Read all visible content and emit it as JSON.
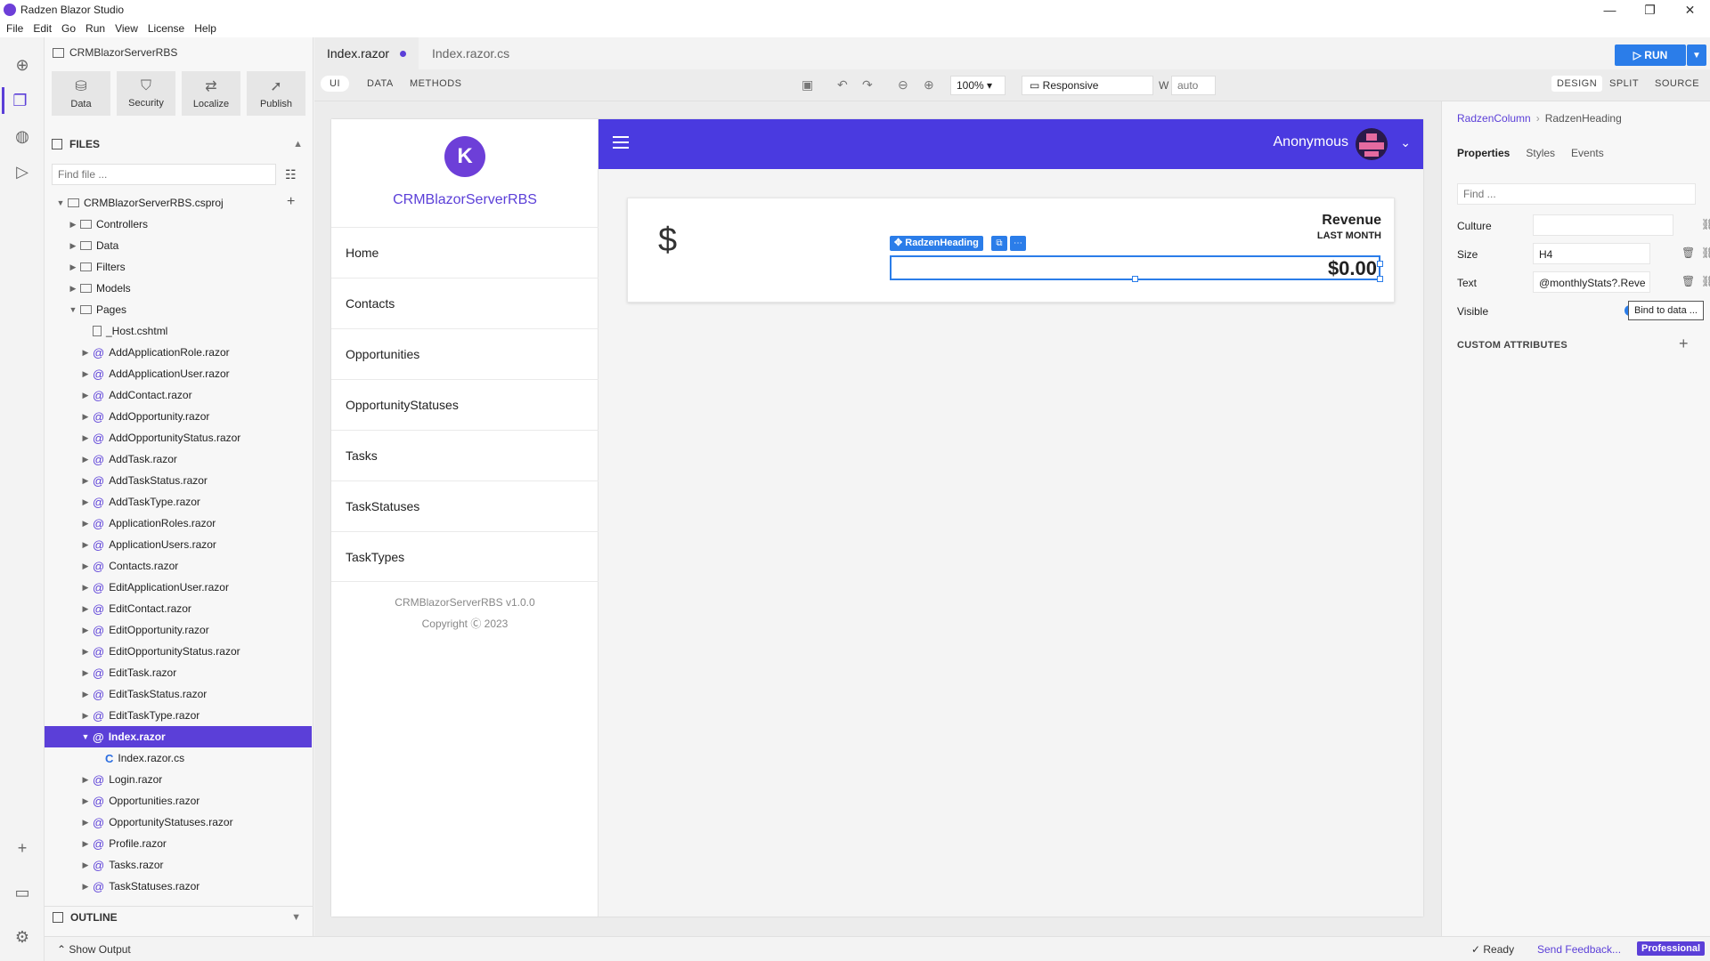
{
  "window": {
    "title": "Radzen Blazor Studio",
    "controls": [
      "—",
      "❐",
      "✕"
    ]
  },
  "menu": [
    "File",
    "Edit",
    "Go",
    "Run",
    "View",
    "License",
    "Help"
  ],
  "activity_icons": [
    "components-icon",
    "files-icon",
    "palette-icon",
    "run-debug-icon",
    "add-icon",
    "folder-open-icon",
    "settings-icon"
  ],
  "project": {
    "title": "CRMBlazorServerRBS",
    "tools": [
      {
        "label": "Data",
        "icon": "database-icon"
      },
      {
        "label": "Security",
        "icon": "shield-icon"
      },
      {
        "label": "Localize",
        "icon": "translate-icon"
      },
      {
        "label": "Publish",
        "icon": "rocket-icon"
      }
    ]
  },
  "files": {
    "header": "FILES",
    "find_placeholder": "Find file ...",
    "tree": [
      {
        "label": "CRMBlazorServerRBS.csproj",
        "depth": 0,
        "kind": "folder",
        "expanded": true
      },
      {
        "label": "Controllers",
        "depth": 1,
        "kind": "folder"
      },
      {
        "label": "Data",
        "depth": 1,
        "kind": "folder"
      },
      {
        "label": "Filters",
        "depth": 1,
        "kind": "folder"
      },
      {
        "label": "Models",
        "depth": 1,
        "kind": "folder"
      },
      {
        "label": "Pages",
        "depth": 1,
        "kind": "folder",
        "expanded": true
      },
      {
        "label": "_Host.cshtml",
        "depth": 2,
        "kind": "file"
      },
      {
        "label": "AddApplicationRole.razor",
        "depth": 2,
        "kind": "razor"
      },
      {
        "label": "AddApplicationUser.razor",
        "depth": 2,
        "kind": "razor"
      },
      {
        "label": "AddContact.razor",
        "depth": 2,
        "kind": "razor"
      },
      {
        "label": "AddOpportunity.razor",
        "depth": 2,
        "kind": "razor"
      },
      {
        "label": "AddOpportunityStatus.razor",
        "depth": 2,
        "kind": "razor"
      },
      {
        "label": "AddTask.razor",
        "depth": 2,
        "kind": "razor"
      },
      {
        "label": "AddTaskStatus.razor",
        "depth": 2,
        "kind": "razor"
      },
      {
        "label": "AddTaskType.razor",
        "depth": 2,
        "kind": "razor"
      },
      {
        "label": "ApplicationRoles.razor",
        "depth": 2,
        "kind": "razor"
      },
      {
        "label": "ApplicationUsers.razor",
        "depth": 2,
        "kind": "razor"
      },
      {
        "label": "Contacts.razor",
        "depth": 2,
        "kind": "razor"
      },
      {
        "label": "EditApplicationUser.razor",
        "depth": 2,
        "kind": "razor"
      },
      {
        "label": "EditContact.razor",
        "depth": 2,
        "kind": "razor"
      },
      {
        "label": "EditOpportunity.razor",
        "depth": 2,
        "kind": "razor"
      },
      {
        "label": "EditOpportunityStatus.razor",
        "depth": 2,
        "kind": "razor"
      },
      {
        "label": "EditTask.razor",
        "depth": 2,
        "kind": "razor"
      },
      {
        "label": "EditTaskStatus.razor",
        "depth": 2,
        "kind": "razor"
      },
      {
        "label": "EditTaskType.razor",
        "depth": 2,
        "kind": "razor"
      },
      {
        "label": "Index.razor",
        "depth": 2,
        "kind": "razor",
        "selected": true,
        "expanded": true
      },
      {
        "label": "Index.razor.cs",
        "depth": 3,
        "kind": "cs"
      },
      {
        "label": "Login.razor",
        "depth": 2,
        "kind": "razor"
      },
      {
        "label": "Opportunities.razor",
        "depth": 2,
        "kind": "razor"
      },
      {
        "label": "OpportunityStatuses.razor",
        "depth": 2,
        "kind": "razor"
      },
      {
        "label": "Profile.razor",
        "depth": 2,
        "kind": "razor"
      },
      {
        "label": "Tasks.razor",
        "depth": 2,
        "kind": "razor"
      },
      {
        "label": "TaskStatuses.razor",
        "depth": 2,
        "kind": "razor"
      }
    ]
  },
  "outline": {
    "label": "OUTLINE"
  },
  "status": {
    "output": "Show Output",
    "ready": "✓ Ready",
    "feedback": "Send Feedback...",
    "edition": "Professional"
  },
  "editor_tabs": [
    {
      "label": "Index.razor",
      "active": true,
      "modified": true
    },
    {
      "label": "Index.razor.cs",
      "active": false
    }
  ],
  "run": {
    "label": "▷ RUN"
  },
  "designer": {
    "modes": [
      "UI",
      "DATA",
      "METHODS"
    ],
    "active_mode": "UI",
    "zoom": "100%",
    "device": "Responsive",
    "width_label": "W",
    "width_value": "auto",
    "views": [
      "DESIGN",
      "SPLIT",
      "SOURCE"
    ],
    "active_view": "DESIGN"
  },
  "app": {
    "name": "CRMBlazorServerRBS",
    "logo_letter": "K",
    "nav": [
      "Home",
      "Contacts",
      "Opportunities",
      "OpportunityStatuses",
      "Tasks",
      "TaskStatuses",
      "TaskTypes"
    ],
    "footer_version": "CRMBlazorServerRBS v1.0.0",
    "footer_copyright": "Copyright Ⓒ 2023",
    "user": "Anonymous",
    "card": {
      "symbol": "$",
      "title": "Revenue",
      "subtitle": "LAST MONTH",
      "value": "$0.00"
    },
    "selection": {
      "tag": "RadzenHeading"
    }
  },
  "properties": {
    "breadcrumb_parent": "RadzenColumn",
    "breadcrumb_current": "RadzenHeading",
    "tabs": [
      "Properties",
      "Styles",
      "Events"
    ],
    "active_tab": "Properties",
    "find_placeholder": "Find ...",
    "rows": [
      {
        "label": "Culture",
        "value": ""
      },
      {
        "label": "Size",
        "value": "H4"
      },
      {
        "label": "Text",
        "value": "@monthlyStats?.Reve"
      },
      {
        "label": "Visible",
        "value": ""
      }
    ],
    "tooltip": "Bind to data ...",
    "custom_attributes": "CUSTOM ATTRIBUTES"
  },
  "colors": {
    "accent": "#5b3fd8",
    "topbar": "#4a3ae0",
    "run": "#2b7de9"
  }
}
